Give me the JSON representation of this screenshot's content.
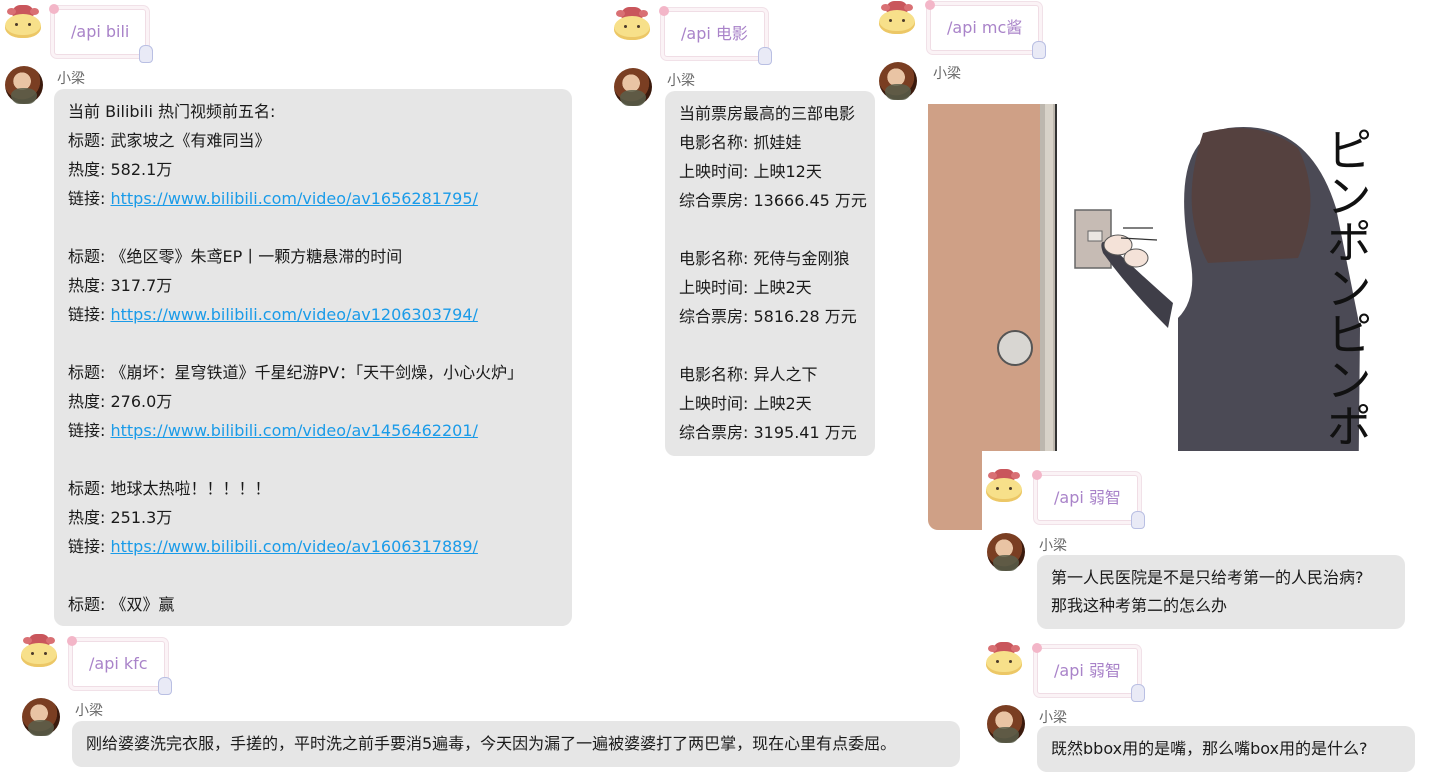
{
  "sender": "小梁",
  "colors": {
    "accent": "#a983c9",
    "link": "#1a9be8",
    "bubble": "#e6e6e6"
  },
  "bili": {
    "command": "/api bili",
    "lines": [
      "当前 Bilibili 热门视频前五名:",
      "标题: 武家坡之《有难同当》",
      "热度: 582.1万",
      {
        "prefix": "链接: ",
        "link": "https://www.bilibili.com/video/av1656281795/"
      },
      "",
      "标题: 《绝区零》朱鸢EP丨一颗方糖悬滞的时间",
      "热度: 317.7万",
      {
        "prefix": "链接: ",
        "link": "https://www.bilibili.com/video/av1206303794/"
      },
      "",
      "标题: 《崩坏：星穹铁道》千星纪游PV：「天干剑燥，小心火炉」",
      "热度: 276.0万",
      {
        "prefix": "链接: ",
        "link": "https://www.bilibili.com/video/av1456462201/"
      },
      "",
      "标题: 地球太热啦！！！！！",
      "热度: 251.3万",
      {
        "prefix": "链接: ",
        "link": "https://www.bilibili.com/video/av1606317889/"
      },
      "",
      "标题: 《双》赢"
    ]
  },
  "movie": {
    "command": "/api 电影",
    "lines": [
      "当前票房最高的三部电影",
      "电影名称: 抓娃娃",
      "上映时间: 上映12天",
      "综合票房: 13666.45 万元",
      "",
      "电影名称: 死侍与金刚狼",
      "上映时间: 上映2天",
      "综合票房: 5816.28 万元",
      "",
      "电影名称: 异人之下",
      "上映时间: 上映2天",
      "综合票房: 3195.41 万元"
    ]
  },
  "mc": {
    "command": "/api mc酱",
    "image_text": "ピンポンピンポンピンポン"
  },
  "ruozhi1": {
    "command": "/api 弱智",
    "lines": [
      "第一人民医院是不是只给考第一的人民治病?",
      "那我这种考第二的怎么办"
    ]
  },
  "ruozhi2": {
    "command": "/api 弱智",
    "text": "既然bbox用的是嘴，那么嘴box用的是什么?"
  },
  "kfc": {
    "command": "/api kfc",
    "text": "刚给婆婆洗完衣服，手搓的，平时洗之前手要消5遍毒，今天因为漏了一遍被婆婆打了两巴掌，现在心里有点委屈。"
  }
}
